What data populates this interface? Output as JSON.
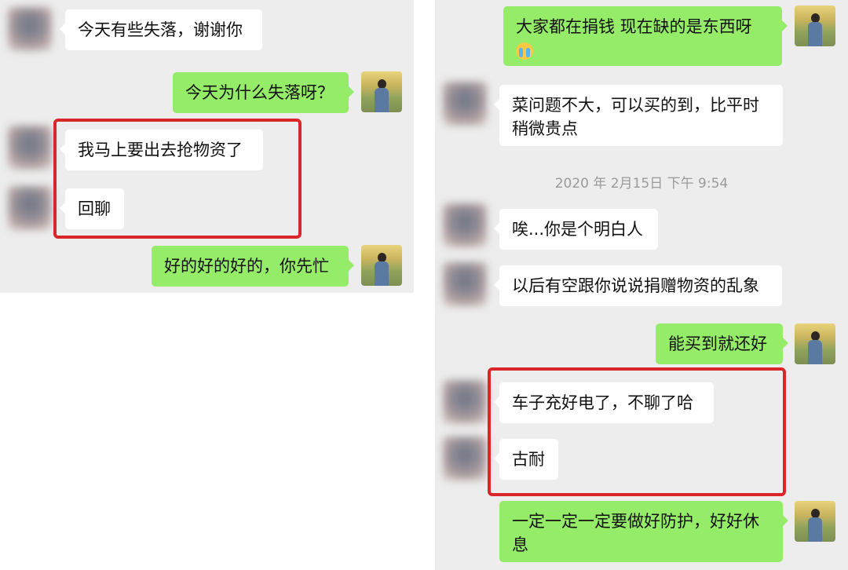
{
  "left_chat": {
    "messages": [
      {
        "text": "今天有些失落，谢谢你"
      },
      {
        "text": "今天为什么失落呀？"
      },
      {
        "text": "我马上要出去抢物资了"
      },
      {
        "text": "回聊"
      },
      {
        "text": "好的好的好的，你先忙"
      }
    ]
  },
  "right_chat": {
    "messages": [
      {
        "text": "大家都在捐钱   现在缺的是东西呀",
        "emoji": "crying-face-icon"
      },
      {
        "text": "菜问题不大，可以买的到，比平时稍微贵点"
      },
      {
        "text": "唉...你是个明白人"
      },
      {
        "text": "以后有空跟你说说捐赠物资的乱象"
      },
      {
        "text": "能买到就还好"
      },
      {
        "text": "车子充好电了，不聊了哈"
      },
      {
        "text": "古耐"
      },
      {
        "text": "一定一定一定要做好防护，好好休息"
      }
    ],
    "timestamp": "2020 年 2月15日 下午 9:54"
  },
  "colors": {
    "chat_background": "#ededed",
    "incoming_bubble": "#ffffff",
    "outgoing_bubble": "#95ec69",
    "highlight_box": "#d9262b",
    "timestamp_text": "#9a9a9a"
  }
}
